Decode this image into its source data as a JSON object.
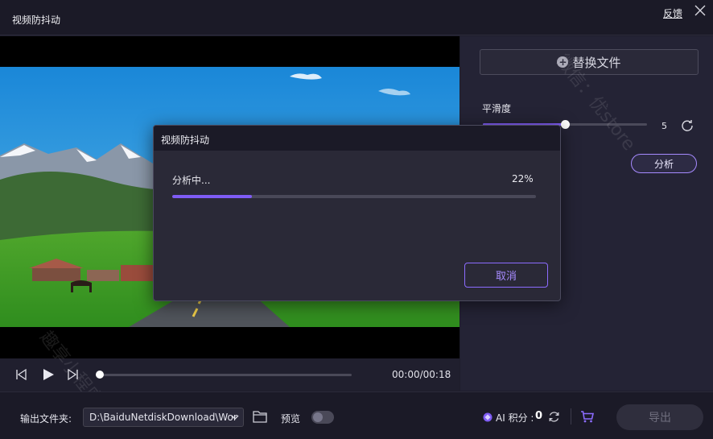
{
  "window": {
    "title": "视频防抖动",
    "feedback_label": "反馈",
    "close_icon": "close-icon"
  },
  "player": {
    "time_display": "00:00/00:18",
    "playhead_fraction": 0.0,
    "icons": [
      "skip-back-icon",
      "play-icon",
      "skip-forward-icon"
    ]
  },
  "settings": {
    "replace_file_label": "替换文件",
    "smoothness_label": "平滑度",
    "smoothness_value": "5",
    "smoothness_min": 0,
    "smoothness_max": 10,
    "analyze_label": "分析"
  },
  "bottom": {
    "output_folder_label": "输出文件夹:",
    "output_path": "D:\\BaiduNetdiskDownload\\Wor",
    "preview_label": "预览",
    "preview_enabled": false,
    "ai_points_label": "AI 积分 :",
    "ai_points_value": "0",
    "export_label": "导出"
  },
  "dialog": {
    "title": "视频防抖动",
    "status": "分析中...",
    "progress_text": "22%",
    "progress_fraction": 0.22,
    "cancel_label": "取消"
  },
  "watermarks": [
    "趣享小程序",
    "趣享小程序",
    "微信：优store"
  ],
  "colors": {
    "accent": "#7f5cf5",
    "accent_light": "#a78bff",
    "background": "#1e1d2b",
    "panel": "#242335"
  }
}
